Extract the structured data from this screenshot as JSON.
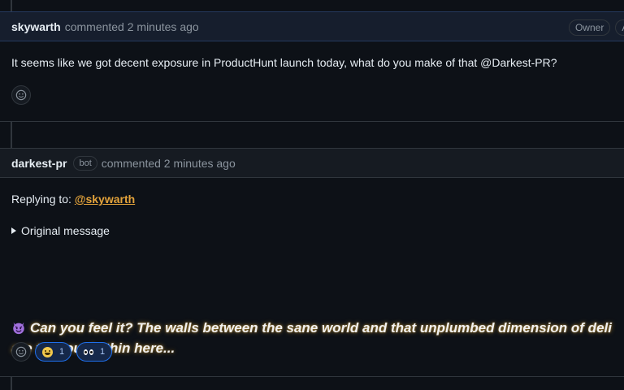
{
  "comments": [
    {
      "author": "skywarth",
      "meta": "commented 2 minutes ago",
      "badges": [
        "Owner",
        "Auth"
      ],
      "body": "It seems like we got decent exposure in ProductHunt launch today, what do you make of that @Darkest-PR?"
    },
    {
      "author": "darkest-pr",
      "bot_label": "bot",
      "meta": "commented 2 minutes ago",
      "reply_prefix": "Replying to:",
      "reply_mention": "@skywarth",
      "details_summary": "Original message",
      "dramatic_line1": "Can you feel it? The walls between the sane world and that unplumbed dimension of deli",
      "dramatic_line2": "are tenuously thin here...",
      "reactions": [
        {
          "emoji": "grinning-face",
          "count": "1"
        },
        {
          "emoji": "eyes",
          "count": "1"
        }
      ]
    }
  ],
  "colors": {
    "background": "#0d1117",
    "header_highlight": "#161e2d",
    "mention": "#e3a33b",
    "reaction_border": "#1f6feb"
  },
  "icons": [
    "smiley-icon",
    "devil-emoji-icon",
    "disclosure-triangle-icon"
  ]
}
